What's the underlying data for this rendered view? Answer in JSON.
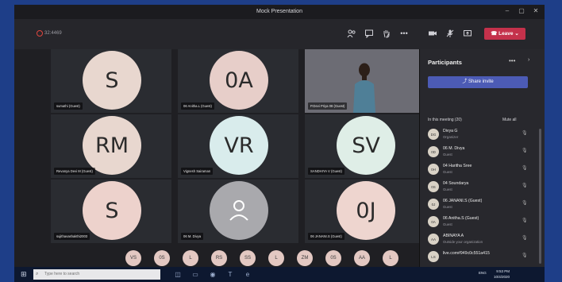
{
  "window": {
    "title": "Mock Presentation",
    "controls": [
      "minimize-icon",
      "maximize-icon",
      "close-icon"
    ]
  },
  "toolbar": {
    "timer": "32:4469",
    "icons": [
      "people-icon",
      "chat-icon",
      "raise-hand-icon",
      "more-icon",
      "camera-icon",
      "mic-icon",
      "share-screen-icon"
    ],
    "more_label": "•••",
    "leave_label": "Leave",
    "leave_color": "#c4314b"
  },
  "tiles": [
    {
      "initials": "S",
      "name": "sumathi (Guest)",
      "color": "#e8d7cf"
    },
    {
      "initials": "0A",
      "name": "06 Anitha.L (Guest)",
      "color": "#e7cec9"
    },
    {
      "initials": "",
      "name": "P.Devi Priya 08 (Guest)",
      "color": "#6c6c74",
      "video": true
    },
    {
      "initials": "RM",
      "name": "Revanya Devi M (Guest)",
      "color": "#e8d7cf"
    },
    {
      "initials": "VR",
      "name": "Vignesh Sairaman",
      "color": "#d9ecec"
    },
    {
      "initials": "SV",
      "name": "SANDHIYA V (Guest)",
      "color": "#dfeee7"
    },
    {
      "initials": "S",
      "name": "sujithavashakthi2003",
      "color": "#edd2cc"
    },
    {
      "initials": "",
      "name": "06 M. Divya",
      "color": "#aaaaaa",
      "placeholder": true
    },
    {
      "initials": "0J",
      "name": "06 JANANI.S (Guest)",
      "color": "#eed5cf"
    }
  ],
  "strip": [
    "VS",
    "0S",
    "L",
    "RS",
    "SS",
    "L",
    "ZM",
    "0S",
    "AA",
    "L"
  ],
  "panel": {
    "title": "Participants",
    "more": "•••",
    "share_invite": "Share invite",
    "in_meeting": "In this meeting (20)",
    "mute_all": "Mute all",
    "participants": [
      {
        "initials": "DG",
        "name": "Divya G",
        "role": "Organizer"
      },
      {
        "initials": "0D",
        "name": "06 M. Divya",
        "role": "Guest"
      },
      {
        "initials": "0H",
        "name": "04 Haritha Sree",
        "role": "Guest"
      },
      {
        "initials": "0S",
        "name": "04 Soundarya",
        "role": "Guest"
      },
      {
        "initials": "0J",
        "name": "06 JANANI.S (Guest)",
        "role": "Guest"
      },
      {
        "initials": "0A",
        "name": "06 Anitha.S (Guest)",
        "role": "Guest"
      },
      {
        "initials": "AA",
        "name": "ABINAYA A",
        "role": "Outside your organization"
      },
      {
        "initials": "LS",
        "name": "live.com#949c0c551a415",
        "role": ""
      }
    ]
  },
  "taskbar": {
    "search_placeholder": "Type here to search",
    "lang": "ENG",
    "time": "9:53 PM",
    "date": "10/4/2020",
    "icons": [
      "task-view-icon",
      "file-explorer-icon",
      "chrome-icon",
      "teams-icon",
      "edge-icon"
    ]
  },
  "colors": {
    "accent": "#4c5bb5",
    "bezel": "#1e3e88"
  }
}
